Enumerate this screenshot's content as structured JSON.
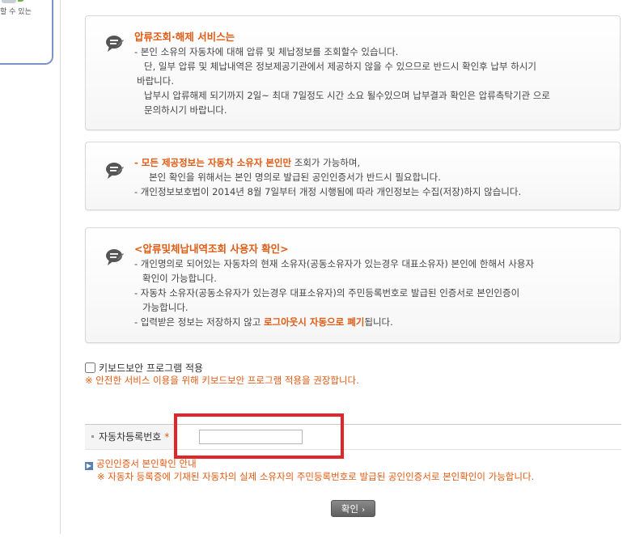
{
  "left_card": {
    "text": "할 수 있는"
  },
  "box1": {
    "title": "압류조회·해제 서비스는",
    "lines": [
      "- 본인 소유의 자동차에 대해 압류 및 체납정보를 조회할수 있습니다.",
      "단, 일부 압류 및 체납내역은 정보제공기관에서 제공하지 않을 수 있으므로 반드시 확인후 납부 하시기",
      "바랍니다.",
      "납부시 압류해제 되기까지 2일~ 최대 7일정도 시간 소요 될수있으며 납부결과 확인은 압류촉탁기관 으로",
      "문의하시기 바랍니다."
    ]
  },
  "box2": {
    "line1_highlight": "- 모든 제공정보는 자동차 소유자 본인만",
    "line1_rest": " 조회가 가능하며,",
    "line2": "본인 확인을 위해서는 본인 명의로 발급된 공인인증서가 반드시 필요합니다.",
    "line3": "- 개인정보보호법이 2014년 8월 7일부터 개정 시행됨에 따라 개인정보는 수집(저장)하지 않습니다."
  },
  "box3": {
    "title": "<압류및체납내역조회 사용자 확인>",
    "line1": "- 개인명의로 되어있는 자동차의 현재 소유자(공동소유자가 있는경우 대표소유자) 본인에 한해서 사용자",
    "line2": "확인이 가능합니다.",
    "line3": "- 자동차 소유자(공동소유자가 있는경우 대표소유자)의 주민등록번호로 발급된 인증서로 본인인증이",
    "line4": "가능합니다.",
    "line5_pre": "- 입력받은 정보는 저장하지 않고 ",
    "line5_highlight": "로그아웃시 자동으로 폐기",
    "line5_post": "됩니다."
  },
  "keyboard": {
    "label": "키보드보안 프로그램 적용",
    "note": "※ 안전한 서비스 이용을 위해 키보드보안 프로그램 적용을 권장합니다."
  },
  "registration": {
    "label": "자동차등록번호",
    "required_mark": "*",
    "value": ""
  },
  "guide": {
    "link": "공인인증서 본인확인 안내",
    "note": "※ 자동차 등록증에 기재된 자동차의 실제 소유자의 주민등록번호로 발급된 공인인증서로 본인확인이 가능합니다."
  },
  "confirm_button": {
    "label": "확인",
    "chevron": "›"
  },
  "colors": {
    "accent_orange": "#e05a12",
    "highlight_red": "#e2242b",
    "link_blue": "#5a7db3"
  }
}
